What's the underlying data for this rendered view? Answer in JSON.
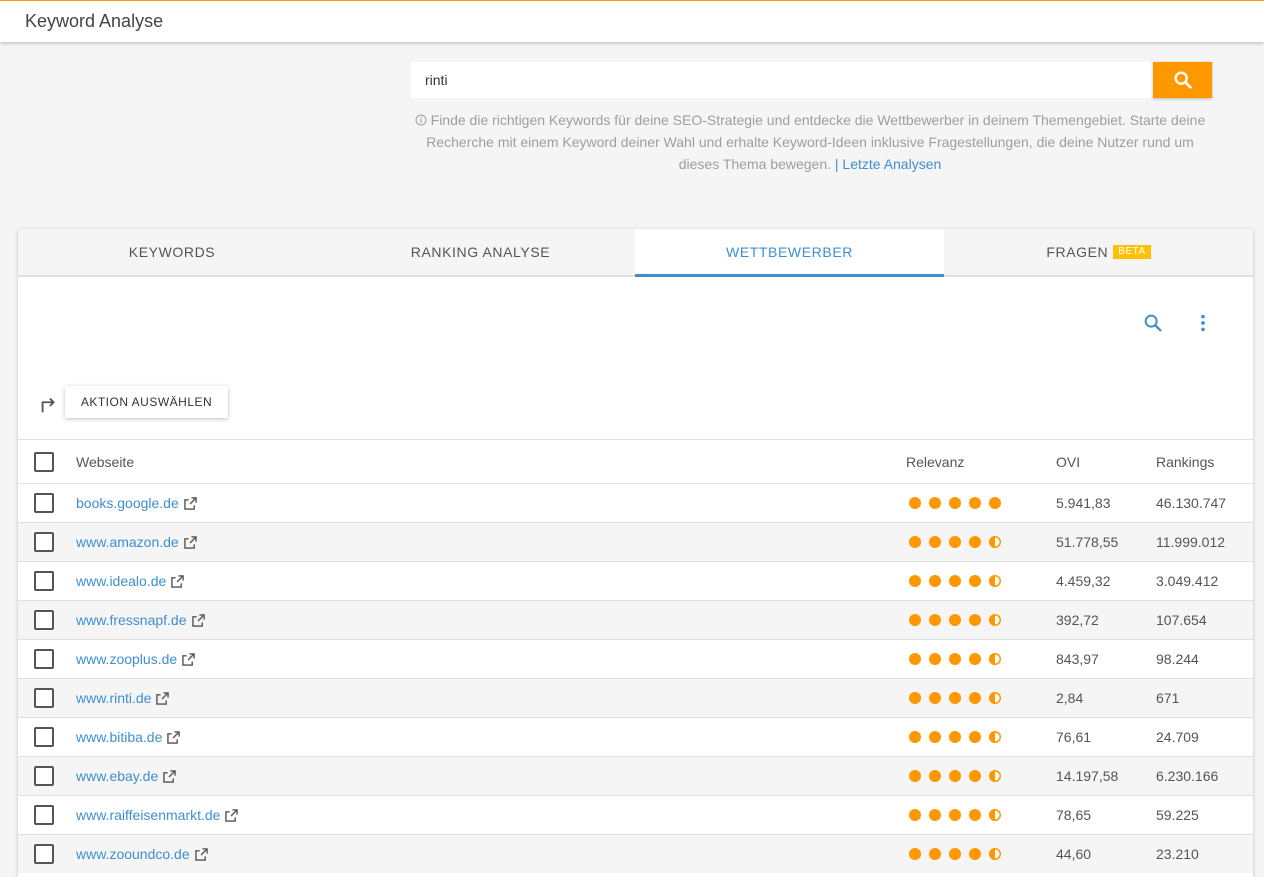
{
  "app": {
    "title": "Keyword Analyse"
  },
  "search": {
    "value": "rinti",
    "button_icon": "search-icon",
    "info_icon": "info-icon",
    "info_text": "Finde die richtigen Keywords für deine SEO-Strategie und entdecke die Wettbewerber in deinem Themengebiet. Starte deine Recherche mit einem Keyword deiner Wahl und erhalte Keyword-Ideen inklusive Fragestellungen, die deine Nutzer rund um dieses Thema bewegen.",
    "link_text": "| Letzte Analysen"
  },
  "tabs": [
    {
      "label": "KEYWORDS",
      "active": false
    },
    {
      "label": "RANKING ANALYSE",
      "active": false
    },
    {
      "label": "WETTBEWERBER",
      "active": true
    },
    {
      "label": "FRAGEN",
      "active": false,
      "badge": "BETA"
    }
  ],
  "toolbar": {
    "search_icon": "search-icon",
    "more_icon": "more-vert-icon"
  },
  "action": {
    "icon": "turn-right-arrow-icon",
    "label": "AKTION AUSWÄHLEN"
  },
  "table": {
    "headers": {
      "site": "Webseite",
      "relevance": "Relevanz",
      "ovi": "OVI",
      "rankings": "Rankings"
    },
    "rows": [
      {
        "site": "books.google.de",
        "relevance": 5,
        "ovi": "5.941,83",
        "rankings": "46.130.747"
      },
      {
        "site": "www.amazon.de",
        "relevance": 4.5,
        "ovi": "51.778,55",
        "rankings": "11.999.012"
      },
      {
        "site": "www.idealo.de",
        "relevance": 4.5,
        "ovi": "4.459,32",
        "rankings": "3.049.412"
      },
      {
        "site": "www.fressnapf.de",
        "relevance": 4.5,
        "ovi": "392,72",
        "rankings": "107.654"
      },
      {
        "site": "www.zooplus.de",
        "relevance": 4.5,
        "ovi": "843,97",
        "rankings": "98.244"
      },
      {
        "site": "www.rinti.de",
        "relevance": 4.5,
        "ovi": "2,84",
        "rankings": "671"
      },
      {
        "site": "www.bitiba.de",
        "relevance": 4.5,
        "ovi": "76,61",
        "rankings": "24.709"
      },
      {
        "site": "www.ebay.de",
        "relevance": 4.5,
        "ovi": "14.197,58",
        "rankings": "6.230.166"
      },
      {
        "site": "www.raiffeisenmarkt.de",
        "relevance": 4.5,
        "ovi": "78,65",
        "rankings": "59.225"
      },
      {
        "site": "www.zooundco.de",
        "relevance": 4.5,
        "ovi": "44,60",
        "rankings": "23.210"
      }
    ]
  },
  "colors": {
    "accent": "#ff9800",
    "link": "#3d8fd1",
    "beta": "#ffc107"
  }
}
